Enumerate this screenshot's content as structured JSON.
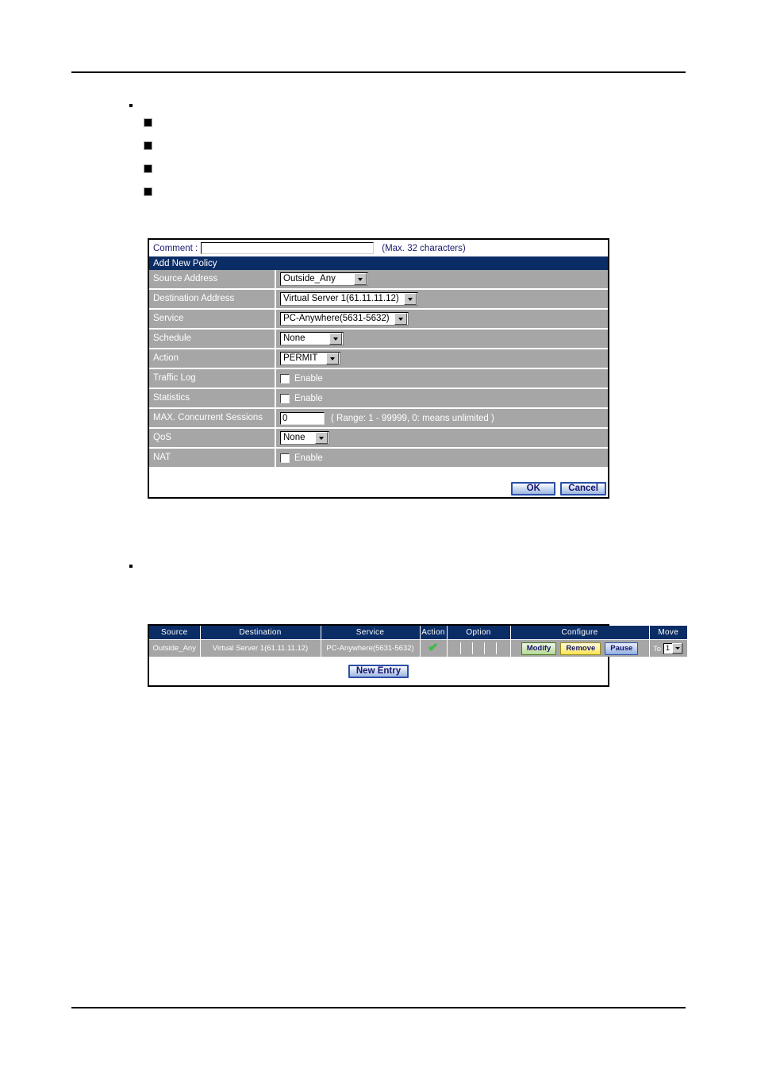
{
  "document": {
    "bullets": {
      "round_marker": "•",
      "square_marker": "■"
    }
  },
  "policy_form": {
    "comment_label": "Comment :",
    "comment_value": "",
    "comment_placeholder": "",
    "comment_hint": "(Max. 32 characters)",
    "panel_title": "Add New Policy",
    "rows": [
      {
        "label": "Source Address",
        "value": "Outside_Any"
      },
      {
        "label": "Destination Address",
        "value": "Virtual Server 1(61.11.11.12)"
      },
      {
        "label": "Service",
        "value": "PC-Anywhere(5631-5632)"
      },
      {
        "label": "Schedule",
        "value": "None"
      },
      {
        "label": "Action",
        "value": "PERMIT"
      },
      {
        "label": "Traffic Log",
        "value": "Enable"
      },
      {
        "label": "Statistics",
        "value": "Enable"
      },
      {
        "label": "MAX. Concurrent Sessions",
        "value": "0",
        "hint": "( Range: 1 - 99999, 0: means unlimited )"
      },
      {
        "label": "QoS",
        "value": "None"
      },
      {
        "label": "NAT",
        "value": "Enable"
      }
    ],
    "ok_label": "OK",
    "cancel_label": "Cancel"
  },
  "policy_table": {
    "headers": [
      "Source",
      "Destination",
      "Service",
      "Action",
      "Option",
      "Configure",
      "Move"
    ],
    "row": {
      "source": "Outside_Any",
      "destination": "Virtual Server 1(61.11.11.12)",
      "service": "PC-Anywhere(5631-5632)",
      "action_icon": "check-mark-icon",
      "option_cells": [
        "",
        "",
        "",
        "",
        ""
      ],
      "modify_label": "Modify",
      "remove_label": "Remove",
      "pause_label": "Pause",
      "move_to_label": "To",
      "move_value": "1"
    },
    "new_entry_label": "New Entry"
  },
  "colors": {
    "panel_header": "#0b2d66",
    "row_label_bg": "#a6a6a6",
    "button_blue_border": "#2b4fa8",
    "button_text": "#16166b",
    "modify_green": "#b3d894",
    "remove_yellow": "#ffe24d",
    "pause_blue": "#8facdf",
    "check_green": "#39c13c"
  }
}
